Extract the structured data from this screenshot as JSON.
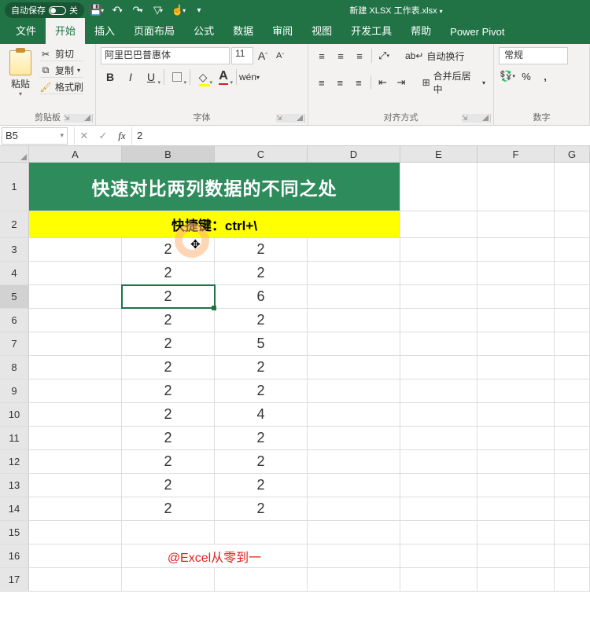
{
  "titlebar": {
    "autosave_label": "自动保存",
    "autosave_state": "关",
    "filename": "新建 XLSX 工作表.xlsx"
  },
  "tabs": {
    "file": "文件",
    "home": "开始",
    "insert": "插入",
    "layout": "页面布局",
    "formulas": "公式",
    "data": "数据",
    "review": "审阅",
    "view": "视图",
    "dev": "开发工具",
    "help": "帮助",
    "powerpivot": "Power Pivot"
  },
  "ribbon": {
    "clipboard": {
      "paste": "粘贴",
      "cut": "剪切",
      "copy": "复制",
      "format_painter": "格式刷",
      "label": "剪贴板"
    },
    "font": {
      "name": "阿里巴巴普惠体",
      "size": "11",
      "inc_a": "A",
      "dec_a": "A",
      "bold": "B",
      "italic": "I",
      "underline": "U",
      "label": "字体"
    },
    "align": {
      "wrap": "自动换行",
      "merge": "合并后居中",
      "label": "对齐方式"
    },
    "number": {
      "format": "常规",
      "label": "数字"
    }
  },
  "namebox": "B5",
  "formula": "2",
  "columns": [
    "A",
    "B",
    "C",
    "D",
    "E",
    "F",
    "G"
  ],
  "row_numbers": [
    "1",
    "2",
    "3",
    "4",
    "5",
    "6",
    "7",
    "8",
    "9",
    "10",
    "11",
    "12",
    "13",
    "14",
    "15",
    "16",
    "17"
  ],
  "banner_title": "快速对比两列数据的不同之处",
  "banner_shortcut": "快捷键：ctrl+\\",
  "col_b": [
    "2",
    "2",
    "2",
    "2",
    "2",
    "2",
    "2",
    "2",
    "2",
    "2",
    "2",
    "2"
  ],
  "col_c": [
    "2",
    "2",
    "6",
    "2",
    "5",
    "2",
    "2",
    "4",
    "2",
    "2",
    "2",
    "2"
  ],
  "credit": "@Excel从零到一",
  "chart_data": {
    "type": "table",
    "title": "快速对比两列数据的不同之处",
    "subtitle": "快捷键：ctrl+\\",
    "columns": [
      "B",
      "C"
    ],
    "rows": [
      {
        "B": 2,
        "C": 2
      },
      {
        "B": 2,
        "C": 2
      },
      {
        "B": 2,
        "C": 6
      },
      {
        "B": 2,
        "C": 2
      },
      {
        "B": 2,
        "C": 5
      },
      {
        "B": 2,
        "C": 2
      },
      {
        "B": 2,
        "C": 2
      },
      {
        "B": 2,
        "C": 4
      },
      {
        "B": 2,
        "C": 2
      },
      {
        "B": 2,
        "C": 2
      },
      {
        "B": 2,
        "C": 2
      },
      {
        "B": 2,
        "C": 2
      }
    ]
  }
}
